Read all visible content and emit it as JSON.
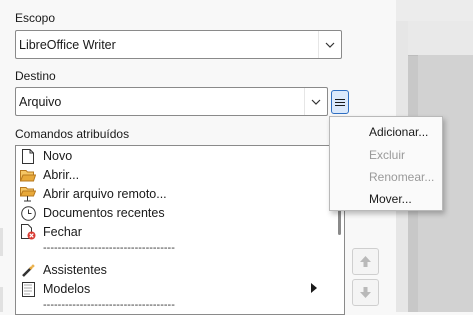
{
  "scope": {
    "label": "Escopo",
    "value": "LibreOffice Writer"
  },
  "destination": {
    "label": "Destino",
    "value": "Arquivo"
  },
  "commands": {
    "label": "Comandos atribuídos",
    "items": [
      {
        "label": "Novo",
        "icon": "new-document-icon"
      },
      {
        "label": "Abrir...",
        "icon": "folder-open-icon"
      },
      {
        "label": "Abrir arquivo remoto...",
        "icon": "remote-folder-icon"
      },
      {
        "label": "Documentos recentes",
        "icon": "clock-icon"
      },
      {
        "label": "Fechar",
        "icon": "close-document-icon"
      },
      {
        "label": "------------------------------------",
        "separator": true
      },
      {
        "label": "Assistentes",
        "icon": "wizard-icon"
      },
      {
        "label": "Modelos",
        "icon": "templates-icon",
        "submenu": true
      },
      {
        "label": "------------------------------------",
        "separator": true
      }
    ]
  },
  "context_menu": {
    "items": [
      {
        "label": "Adicionar...",
        "enabled": true
      },
      {
        "label": "Excluir",
        "enabled": false
      },
      {
        "label": "Renomear...",
        "enabled": false
      },
      {
        "label": "Mover...",
        "enabled": true
      }
    ]
  },
  "colors": {
    "accent": "#2f6fc2",
    "disabled": "#9a9a9a",
    "folder": "#e8a93a",
    "close_badge": "#d93a32"
  }
}
